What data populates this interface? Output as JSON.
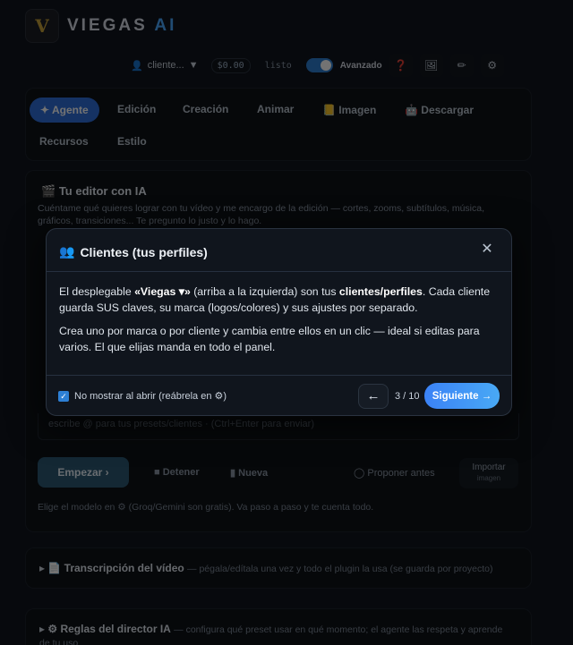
{
  "brand": {
    "name": "VIEGAS",
    "suffix": "AI",
    "logo_letter": "V"
  },
  "topbar": {
    "client_label": "cliente...",
    "cost": "$0.00",
    "status": "listo",
    "advanced_label": "Avanzado",
    "icons": [
      "help-icon",
      "image-icon",
      "brush-icon",
      "gear-icon"
    ]
  },
  "tabs": {
    "agent": "✦ Agente",
    "edit": "Edición",
    "create": "Creación",
    "animate": "Animar",
    "image": "Imagen",
    "download": "Descargar",
    "resources": "Recursos",
    "style": "Estilo"
  },
  "editor": {
    "title": "Tu editor con IA",
    "description": "Cuéntame qué quieres lograr con tu vídeo y me encargo de la edición — cortes, zooms, subtítulos, música, gráficos, transiciones... Te pregunto lo justo y lo hago.",
    "prompt_placeholder": "escribe @ para tus presets/clientes · (Ctrl+Enter para enviar)",
    "start_label": "Empezar ›",
    "stop_label": "Detener",
    "new_label": "Nueva",
    "propose_label": "Proponer antes",
    "import_label": "Importar",
    "import_sub": "imagen",
    "model_hint": "Elige el modelo en ⚙ (Groq/Gemini son gratis). Va paso a paso y te cuenta todo."
  },
  "transcription": {
    "title": "Transcripción del vídeo",
    "subtitle": "— pégala/edítala una vez y todo el plugin la usa (se guarda por proyecto)"
  },
  "director": {
    "title": "⚙ Reglas del director IA",
    "subtitle": "— configura qué preset usar en qué momento; el agente las respeta y aprende de tu uso"
  },
  "modal": {
    "title": "Clientes (tus perfiles)",
    "p1_a": "El desplegable ",
    "p1_b": "«Viegas ▾»",
    "p1_c": " (arriba a la izquierda) son tus ",
    "p1_d": "clientes/perfiles",
    "p1_e": ". Cada cliente guarda SUS claves, su marca (logos/colores) y sus ajustes por separado.",
    "p2": "Crea uno por marca o por cliente y cambia entre ellos en un clic — ideal si editas para varios. El que elijas manda en todo el panel.",
    "dont_show": "No mostrar al abrir (reábrela en ⚙)",
    "prev": "←",
    "counter": "3 / 10",
    "next": "Siguiente →"
  },
  "colors": {
    "accent": "#3b82f6",
    "brand_ai": "#4aa8ff",
    "background": "#07090d"
  }
}
